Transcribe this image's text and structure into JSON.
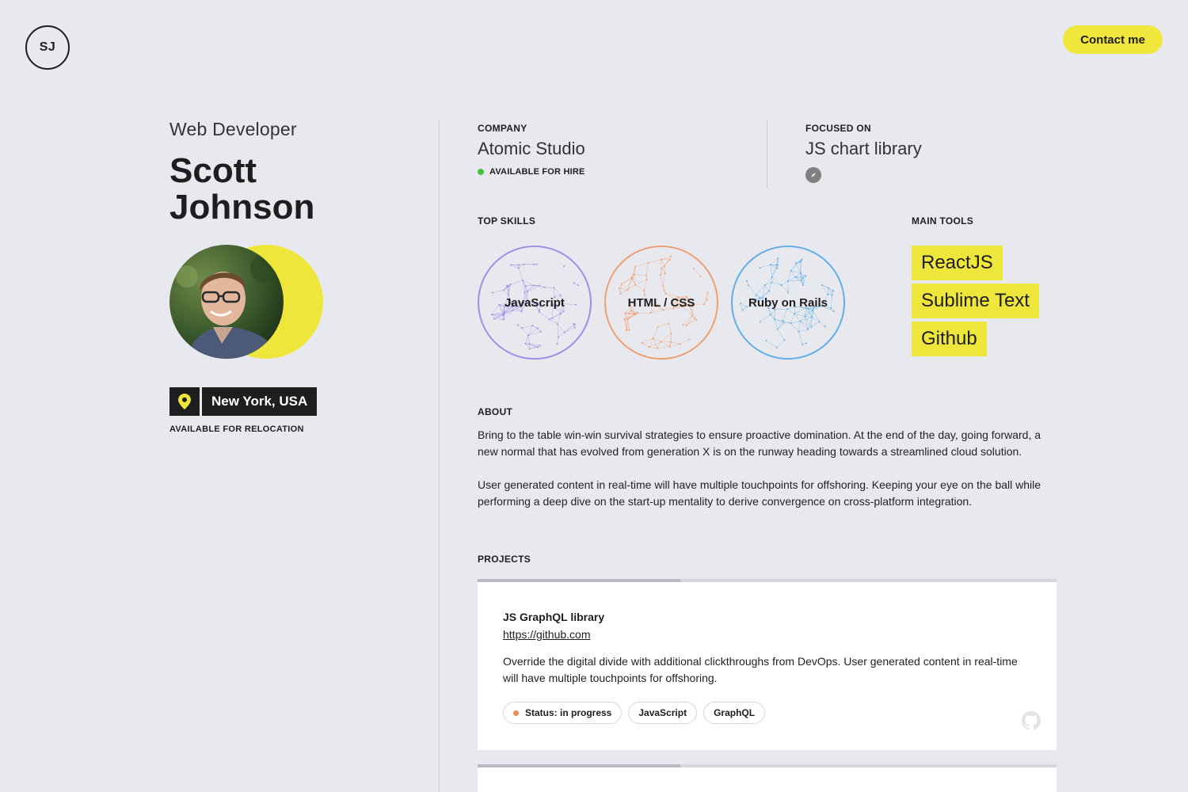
{
  "header": {
    "logo_initials": "SJ",
    "contact_label": "Contact me"
  },
  "profile": {
    "role": "Web Developer",
    "first_name": "Scott",
    "last_name": "Johnson",
    "location": "New York, USA",
    "relocation": "AVAILABLE FOR RELOCATION",
    "accent_color": "#efe63c"
  },
  "company": {
    "label": "COMPANY",
    "name": "Atomic Studio",
    "status": "AVAILABLE FOR HIRE",
    "status_color": "#43c443"
  },
  "focus": {
    "label": "FOCUSED ON",
    "value": "JS chart library",
    "icon": "compass-icon"
  },
  "skills": {
    "label": "TOP SKILLS",
    "items": [
      {
        "name": "JavaScript",
        "color": "#a08ee6"
      },
      {
        "name": "HTML / CSS",
        "color": "#ee9f73"
      },
      {
        "name": "Ruby on Rails",
        "color": "#62aee6"
      }
    ]
  },
  "tools": {
    "label": "MAIN TOOLS",
    "items": [
      "ReactJS",
      "Sublime Text",
      "Github"
    ]
  },
  "about": {
    "label": "ABOUT",
    "paragraphs": [
      "Bring to the table win-win survival strategies to ensure proactive domination. At the end of the day, going forward, a new normal that has evolved from generation X is on the runway heading towards a streamlined cloud solution.",
      "User generated content in real-time will have multiple touchpoints for offshoring. Keeping your eye on the ball while performing a deep dive on the start-up mentality to derive convergence on cross-platform integration."
    ]
  },
  "projects": {
    "label": "PROJECTS",
    "items": [
      {
        "title": "JS GraphQL library",
        "link": "https://github.com",
        "description": "Override the digital divide with additional clickthroughs from DevOps. User generated content in real-time will have multiple touchpoints for offshoring.",
        "progress": 0.35,
        "tags": [
          "Status: in progress",
          "JavaScript",
          "GraphQL"
        ],
        "status_color": "#ee8a55",
        "icon": "github-icon"
      },
      {
        "progress": 0.35
      }
    ]
  }
}
